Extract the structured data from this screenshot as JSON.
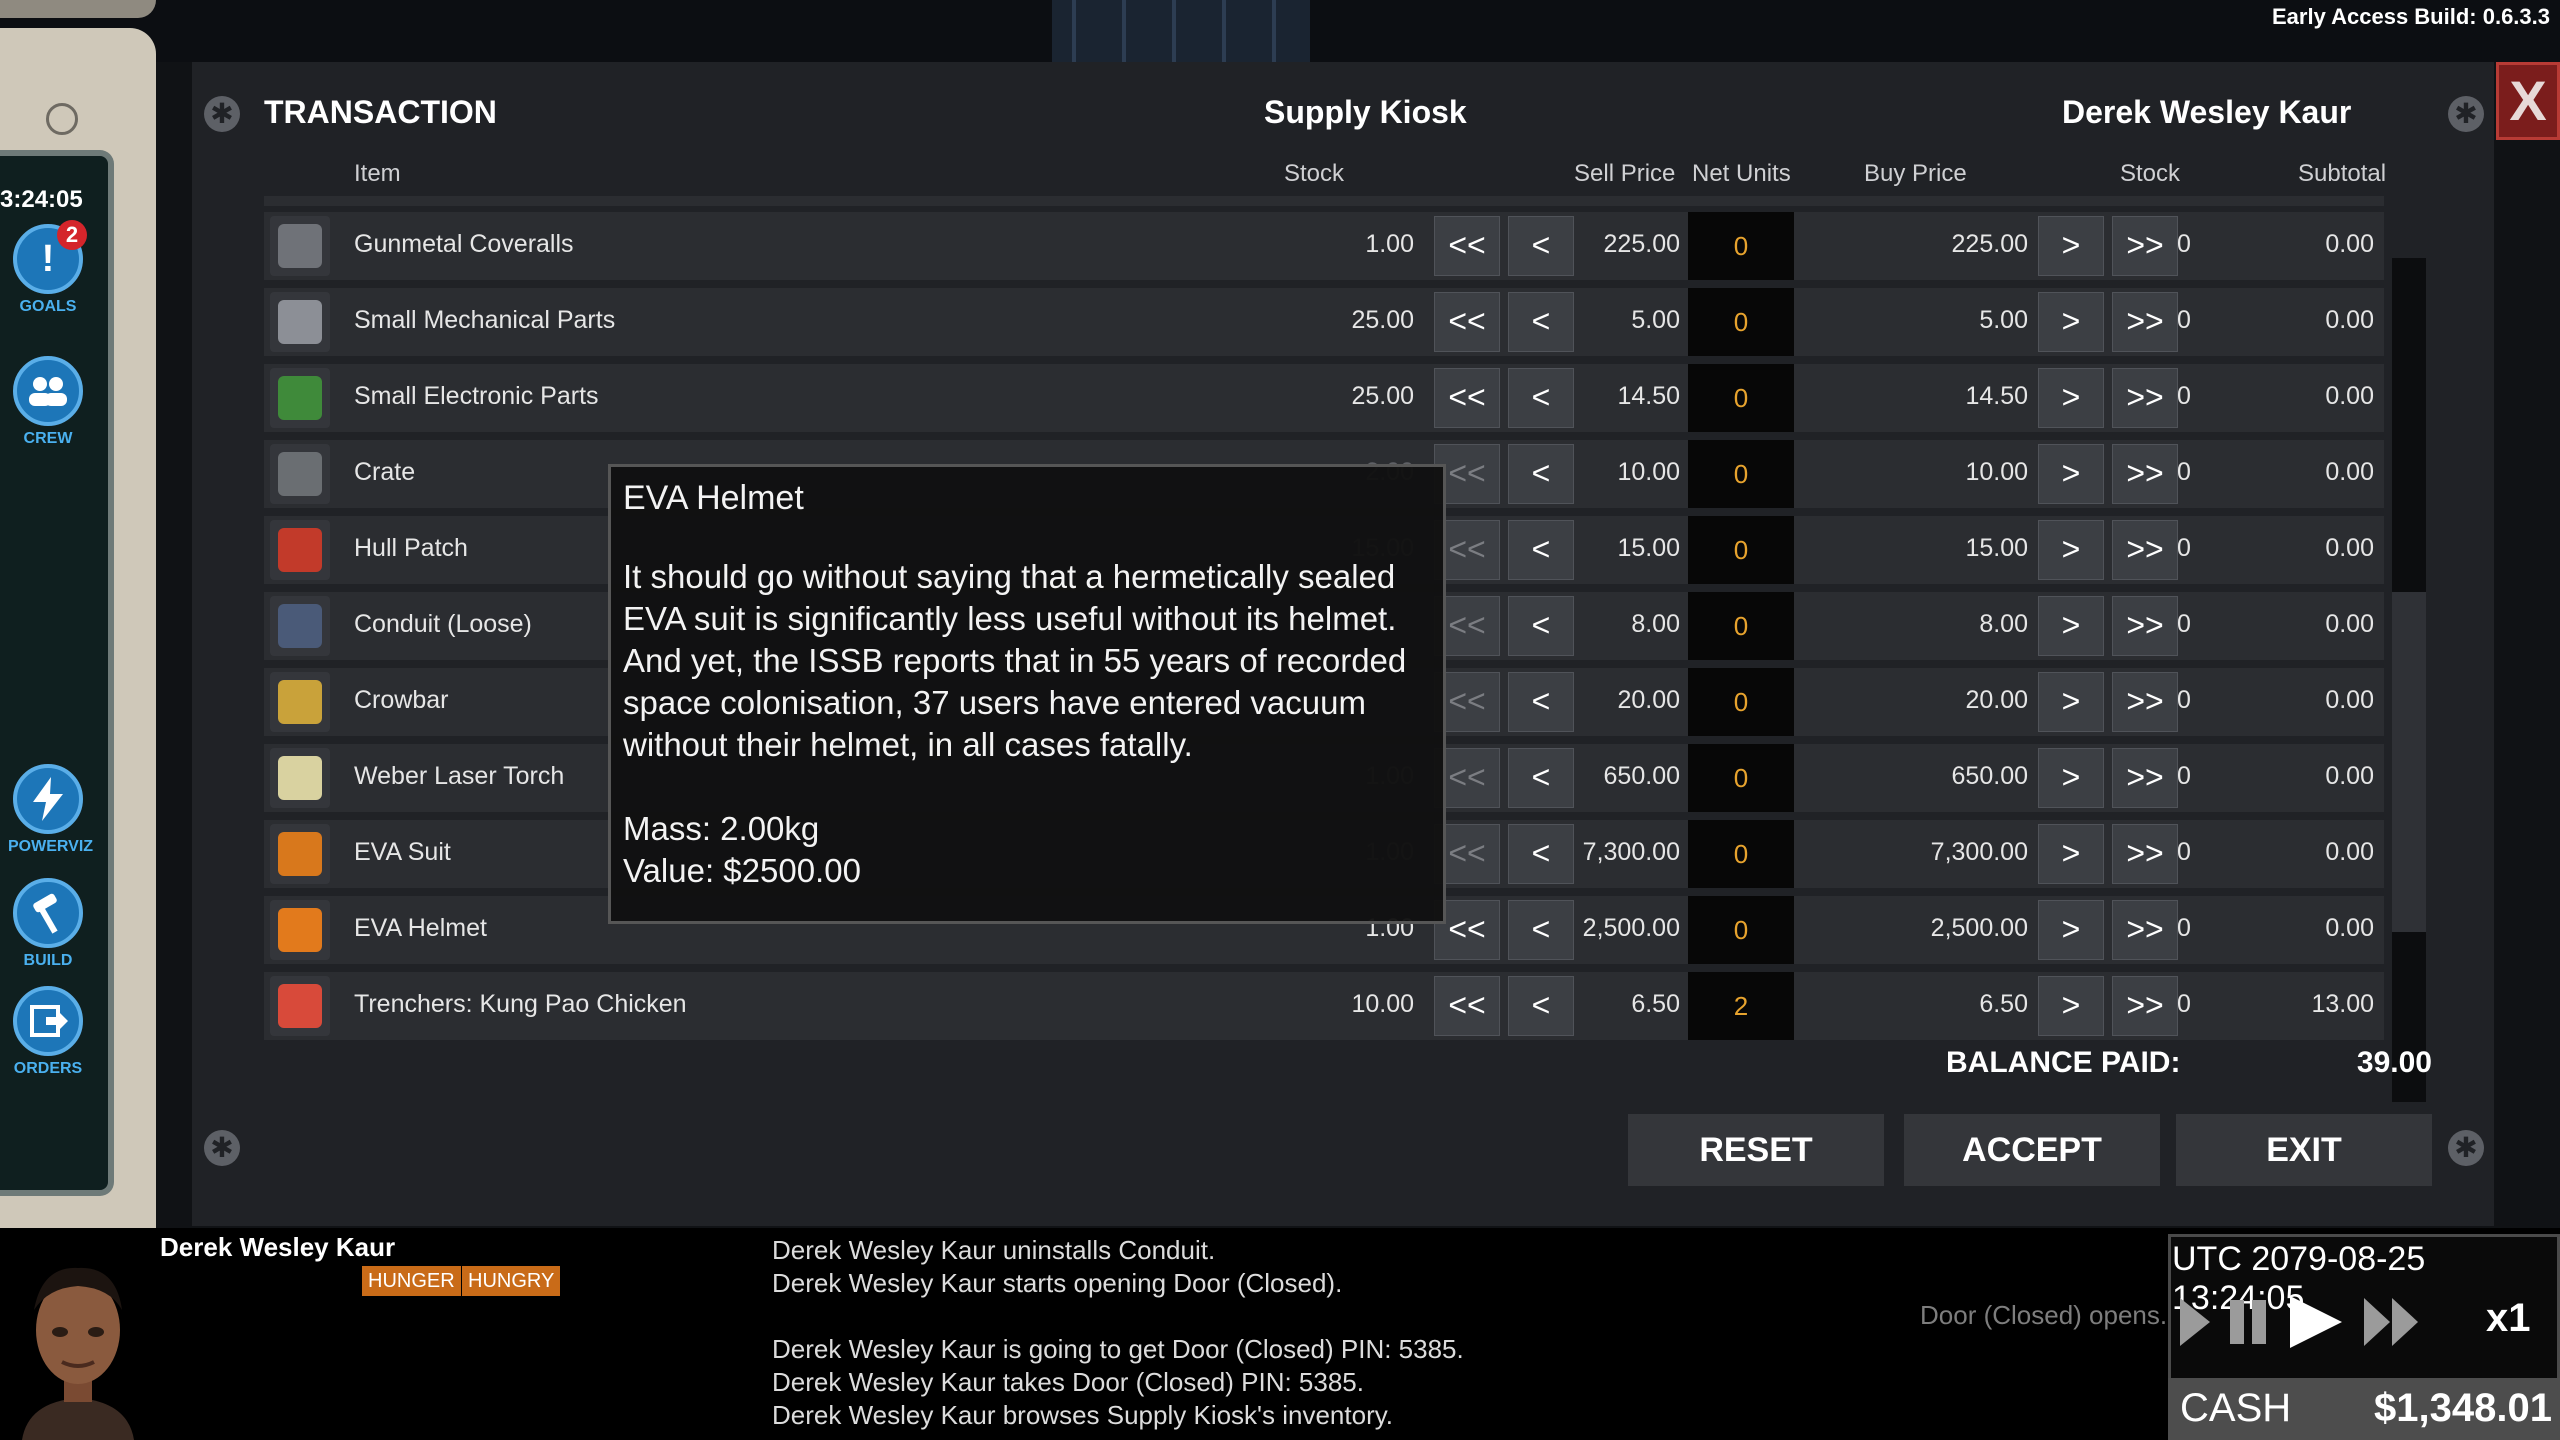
{
  "build_label": "Early Access Build: 0.6.3.3",
  "sidebar": {
    "clock": "3:24:05",
    "buttons": [
      {
        "label": "GOALS",
        "badge": "2"
      },
      {
        "label": "CREW"
      },
      {
        "label": "POWERVIZ"
      },
      {
        "label": "BUILD"
      },
      {
        "label": "ORDERS"
      }
    ]
  },
  "transaction": {
    "title": "TRANSACTION",
    "kiosk": "Supply Kiosk",
    "buyer": "Derek Wesley Kaur",
    "close_label": "X",
    "columns": {
      "item": "Item",
      "stock": "Stock",
      "sell_price": "Sell Price",
      "net_units": "Net Units",
      "buy_price": "Buy Price",
      "stock_buyer": "Stock",
      "subtotal": "Subtotal"
    },
    "button_labels": {
      "sell_all": "<<",
      "sell_one": "<",
      "buy_one": ">",
      "buy_all": ">>"
    },
    "rows": [
      {
        "name": "Gunmetal Coveralls",
        "stock": "1.00",
        "sell": "225.00",
        "net": "0",
        "buy": "225.00",
        "stock_b": "0",
        "subtotal": "0.00"
      },
      {
        "name": "Small Mechanical Parts",
        "stock": "25.00",
        "sell": "5.00",
        "net": "0",
        "buy": "5.00",
        "stock_b": "0",
        "subtotal": "0.00"
      },
      {
        "name": "Small Electronic Parts",
        "stock": "25.00",
        "sell": "14.50",
        "net": "0",
        "buy": "14.50",
        "stock_b": "0",
        "subtotal": "0.00"
      },
      {
        "name": "Crate",
        "stock": "2.00",
        "sell": "10.00",
        "net": "0",
        "buy": "10.00",
        "stock_b": "0",
        "subtotal": "0.00"
      },
      {
        "name": "Hull Patch",
        "stock": "15.00",
        "sell": "15.00",
        "net": "0",
        "buy": "15.00",
        "stock_b": "0",
        "subtotal": "0.00"
      },
      {
        "name": "Conduit (Loose)",
        "stock": "",
        "sell": "8.00",
        "net": "0",
        "buy": "8.00",
        "stock_b": "0",
        "subtotal": "0.00"
      },
      {
        "name": "Crowbar",
        "stock": "",
        "sell": "20.00",
        "net": "0",
        "buy": "20.00",
        "stock_b": "0",
        "subtotal": "0.00"
      },
      {
        "name": "Weber Laser Torch",
        "stock": "1.00",
        "sell": "650.00",
        "net": "0",
        "buy": "650.00",
        "stock_b": "0",
        "subtotal": "0.00"
      },
      {
        "name": "EVA Suit",
        "stock": "1.00",
        "sell": "7,300.00",
        "net": "0",
        "buy": "7,300.00",
        "stock_b": "0",
        "subtotal": "0.00"
      },
      {
        "name": "EVA Helmet",
        "stock": "1.00",
        "sell": "2,500.00",
        "net": "0",
        "buy": "2,500.00",
        "stock_b": "0",
        "subtotal": "0.00"
      },
      {
        "name": "Trenchers: Kung Pao Chicken",
        "stock": "10.00",
        "sell": "6.50",
        "net": "2",
        "buy": "6.50",
        "stock_b": "0",
        "subtotal": "13.00"
      }
    ],
    "balance_label": "BALANCE PAID:",
    "balance_value": "39.00",
    "actions": {
      "reset": "RESET",
      "accept": "ACCEPT",
      "exit": "EXIT"
    }
  },
  "tooltip": {
    "title": "EVA Helmet",
    "description": "It should go without saying that a hermetically sealed EVA suit is significantly less useful without its helmet. And yet, the ISSB reports that in 55 years of recorded space colonisation, 37 users have entered vacuum without their helmet, in all cases fatally.",
    "mass": "Mass: 2.00kg",
    "value": "Value: $2500.00"
  },
  "crew": {
    "name": "Derek Wesley Kaur",
    "tags": [
      "HUNGER",
      "HUNGRY"
    ]
  },
  "log": [
    "Derek Wesley Kaur uninstalls Conduit.",
    "Derek Wesley Kaur starts opening Door (Closed).",
    "",
    "Derek Wesley Kaur is going to get Door (Closed) PIN: 5385.",
    "Derek Wesley Kaur takes Door (Closed) PIN: 5385.",
    "Derek Wesley Kaur browses Supply Kiosk's inventory."
  ],
  "door_message": "Door (Closed) opens.",
  "time": {
    "utc": "UTC 2079-08-25 13:24:05",
    "speed": "x1"
  },
  "cash": {
    "label": "CASH",
    "value": "$1,348.01"
  }
}
